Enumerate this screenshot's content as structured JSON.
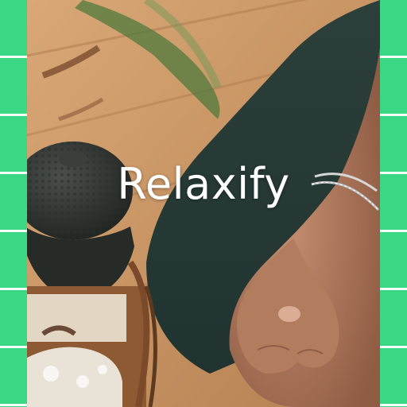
{
  "app": {
    "title": "Relaxify"
  },
  "colors": {
    "accent": "#3ad784",
    "stripe": "#ffffff",
    "title": "#ffffff"
  },
  "scene": {
    "description_icons": [
      "plant-leaf",
      "yoga-mat",
      "stone-figure",
      "wooden-basket",
      "hand-mudra",
      "bracelet"
    ]
  }
}
